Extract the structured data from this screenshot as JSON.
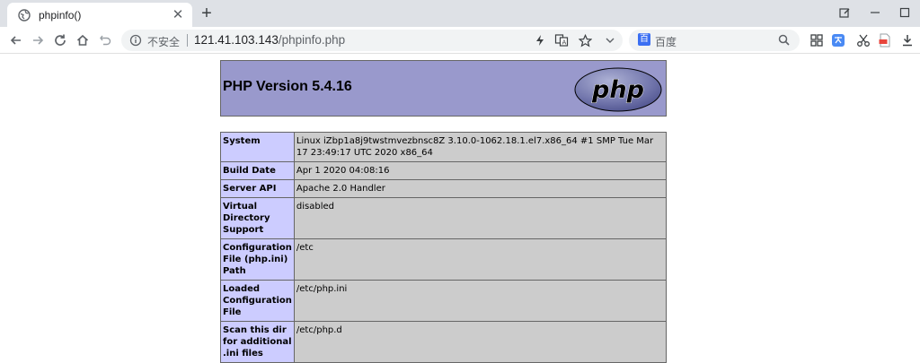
{
  "browser": {
    "tab_title": "phpinfo()",
    "new_tab_label": "+",
    "insecure_label": "不安全",
    "url_host": "121.41.103.143",
    "url_path": "/phpinfo.php",
    "search_placeholder": "百度",
    "search_engine_badge": "百",
    "icons": [
      "globe-icon",
      "close-icon",
      "plus-icon",
      "edit-icon",
      "minimize-icon",
      "maximize-icon",
      "back-icon",
      "forward-icon",
      "reload-icon",
      "home-icon",
      "undo-icon",
      "info-icon",
      "lightning-icon",
      "translate-icon",
      "star-icon",
      "chevron-down-icon",
      "search-icon",
      "grid-icon",
      "translate-ext-icon",
      "scissors-icon",
      "pdf-icon",
      "download-icon"
    ]
  },
  "php": {
    "heading": "PHP Version 5.4.16",
    "logo_text": "php",
    "rows": [
      {
        "label": "System",
        "value": "Linux iZbp1a8j9twstmvezbnsc8Z 3.10.0-1062.18.1.el7.x86_64 #1 SMP Tue Mar 17 23:49:17 UTC 2020 x86_64"
      },
      {
        "label": "Build Date",
        "value": "Apr 1 2020 04:08:16"
      },
      {
        "label": "Server API",
        "value": "Apache 2.0 Handler"
      },
      {
        "label": "Virtual Directory Support",
        "value": "disabled"
      },
      {
        "label": "Configuration File (php.ini) Path",
        "value": "/etc"
      },
      {
        "label": "Loaded Configuration File",
        "value": "/etc/php.ini"
      },
      {
        "label": "Scan this dir for additional .ini files",
        "value": "/etc/php.d"
      }
    ]
  },
  "colors": {
    "header_bg": "#9999cc",
    "label_bg": "#ccccff",
    "value_bg": "#cccccc",
    "border": "#666666",
    "tabbar_bg": "#dee1e6"
  }
}
